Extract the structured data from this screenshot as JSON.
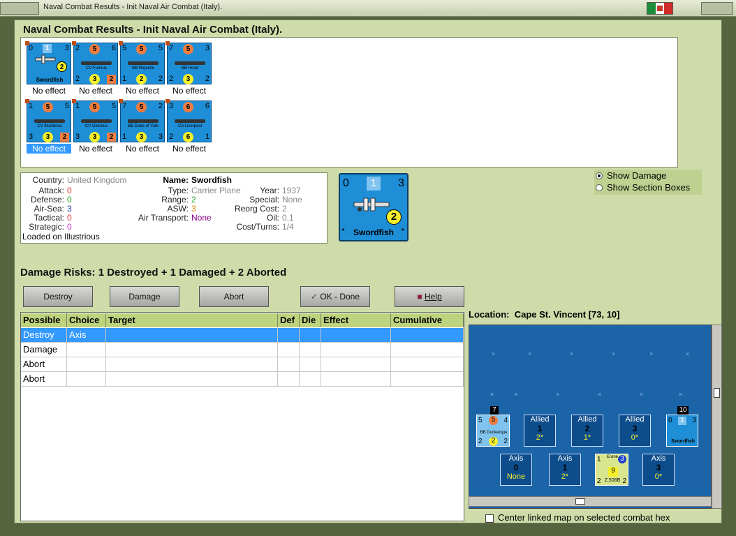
{
  "window": {
    "title": "Naval Combat Results - Init Naval Air Combat (Italy)."
  },
  "dialog": {
    "title": "Naval Combat Results - Init Naval Air Combat (Italy)."
  },
  "units": [
    {
      "name": "Swordfish",
      "tl": "0",
      "mid": "1",
      "tr": "3",
      "br_circle": "2",
      "bl": "",
      "bm": "",
      "br": "",
      "result": "No effect",
      "kind": "plane"
    },
    {
      "name": "CV Furious",
      "tl": "2",
      "mid": "5",
      "tr": "6",
      "bl": "2",
      "bm": "3",
      "br": "2",
      "result": "No effect",
      "kind": "ship"
    },
    {
      "name": "BB Repulse",
      "tl": "5",
      "mid": "5",
      "tr": "5",
      "bl": "1",
      "bm": "2",
      "br": "2",
      "result": "No effect",
      "kind": "ship"
    },
    {
      "name": "BB Hood",
      "tl": "7",
      "mid": "5",
      "tr": "3",
      "bl": "2",
      "bm": "3",
      "br": "2",
      "result": "No effect",
      "kind": "ship"
    },
    {
      "name": "CV Illustrious",
      "tl": "1",
      "mid": "5",
      "tr": "5",
      "bl": "3",
      "bm": "3",
      "br": "2",
      "result": "No effect",
      "kind": "ship"
    },
    {
      "name": "CV Glorious",
      "tl": "1",
      "mid": "5",
      "tr": "5",
      "bl": "3",
      "bm": "3",
      "br": "2",
      "result": "No effect",
      "kind": "ship"
    },
    {
      "name": "BB Duke of York",
      "tl": "7",
      "mid": "5",
      "tr": "2",
      "bl": "1",
      "bm": "3",
      "br": "3",
      "result": "No effect",
      "kind": "ship"
    },
    {
      "name": "CA Liverpool",
      "tl": "3",
      "mid": "6",
      "tr": "6",
      "bl": "2",
      "bm": "6",
      "br": "1",
      "result": "No effect",
      "kind": "ship"
    }
  ],
  "details": {
    "country_label": "Country:",
    "country": "United Kingdom",
    "attack_label": "Attack:",
    "attack": "0",
    "defense_label": "Defense:",
    "defense": "0",
    "airsea_label": "Air-Sea:",
    "airsea": "3",
    "tactical_label": "Tactical:",
    "tactical": "0",
    "strategic_label": "Strategic:",
    "strategic": "0",
    "loaded": "Loaded on Illustrious",
    "name_label": "Name:",
    "name": "Swordfish",
    "type_label": "Type:",
    "type": "Carrier Plane",
    "range_label": "Range:",
    "range": "2",
    "asw_label": "ASW:",
    "asw": "3",
    "airtransport_label": "Air Transport:",
    "airtransport": "None",
    "year_label": "Year:",
    "year": "1937",
    "special_label": "Special:",
    "special": "None",
    "reorg_label": "Reorg Cost:",
    "reorg": "2",
    "oil_label": "Oil:",
    "oil": "0,1",
    "cost_label": "Cost/Turns:",
    "cost": "1/4"
  },
  "bigcard": {
    "tl": "0",
    "mid": "1",
    "tr": "3",
    "circle": "2",
    "name": "Swordfish",
    "star": "*"
  },
  "options": {
    "show_damage": "Show Damage",
    "show_section": "Show Section Boxes"
  },
  "risks": "Damage Risks: 1 Destroyed + 1 Damaged + 2 Aborted",
  "buttons": {
    "destroy": "Destroy",
    "damage": "Damage",
    "abort": "Abort",
    "ok": "OK - Done",
    "help": "Help"
  },
  "table": {
    "headers": [
      "Possible",
      "Choice",
      "Target",
      "Def",
      "Die",
      "Effect",
      "Cumulative"
    ],
    "rows": [
      {
        "possible": "Destroy",
        "choice": "Axis"
      },
      {
        "possible": "Damage",
        "choice": ""
      },
      {
        "possible": "Abort",
        "choice": ""
      },
      {
        "possible": "Abort",
        "choice": ""
      }
    ]
  },
  "location": {
    "label": "Location:",
    "value": "Cape St. Vincent [73, 10]"
  },
  "map": {
    "stack_top_left": "7",
    "stack_top_right": "10",
    "allied": [
      {
        "label": "Allied",
        "num": "1",
        "sub": "2*"
      },
      {
        "label": "Allied",
        "num": "2",
        "sub": "1*"
      },
      {
        "label": "Allied",
        "num": "3",
        "sub": "0*"
      }
    ],
    "axis": [
      {
        "label": "Axis",
        "num": "0",
        "sub": "None"
      },
      {
        "label": "Axis",
        "num": "1",
        "sub": "2*"
      },
      {
        "label": "Axis",
        "num": "3",
        "sub": "0*"
      }
    ],
    "ship_counter": {
      "name": "BB Dunkerque",
      "tl": "5",
      "mid": "5",
      "tr": "4",
      "bl": "2",
      "bm": "2",
      "br": "2"
    },
    "plane_counter": {
      "name": "Swordfish",
      "tl": "0",
      "mid": "1",
      "tr": "3"
    },
    "axis_plane": {
      "name": "Erone",
      "tl": "1",
      "circle": "3",
      "mid": "9",
      "bl": "2",
      "code": "Z.506B",
      "br": "2"
    }
  },
  "center_map": "Center linked map on selected combat hex",
  "colors": {
    "accent": "#1e8ed6",
    "panel": "#cfdcaa",
    "header": "#bdd37e",
    "selected": "#3399ff"
  }
}
